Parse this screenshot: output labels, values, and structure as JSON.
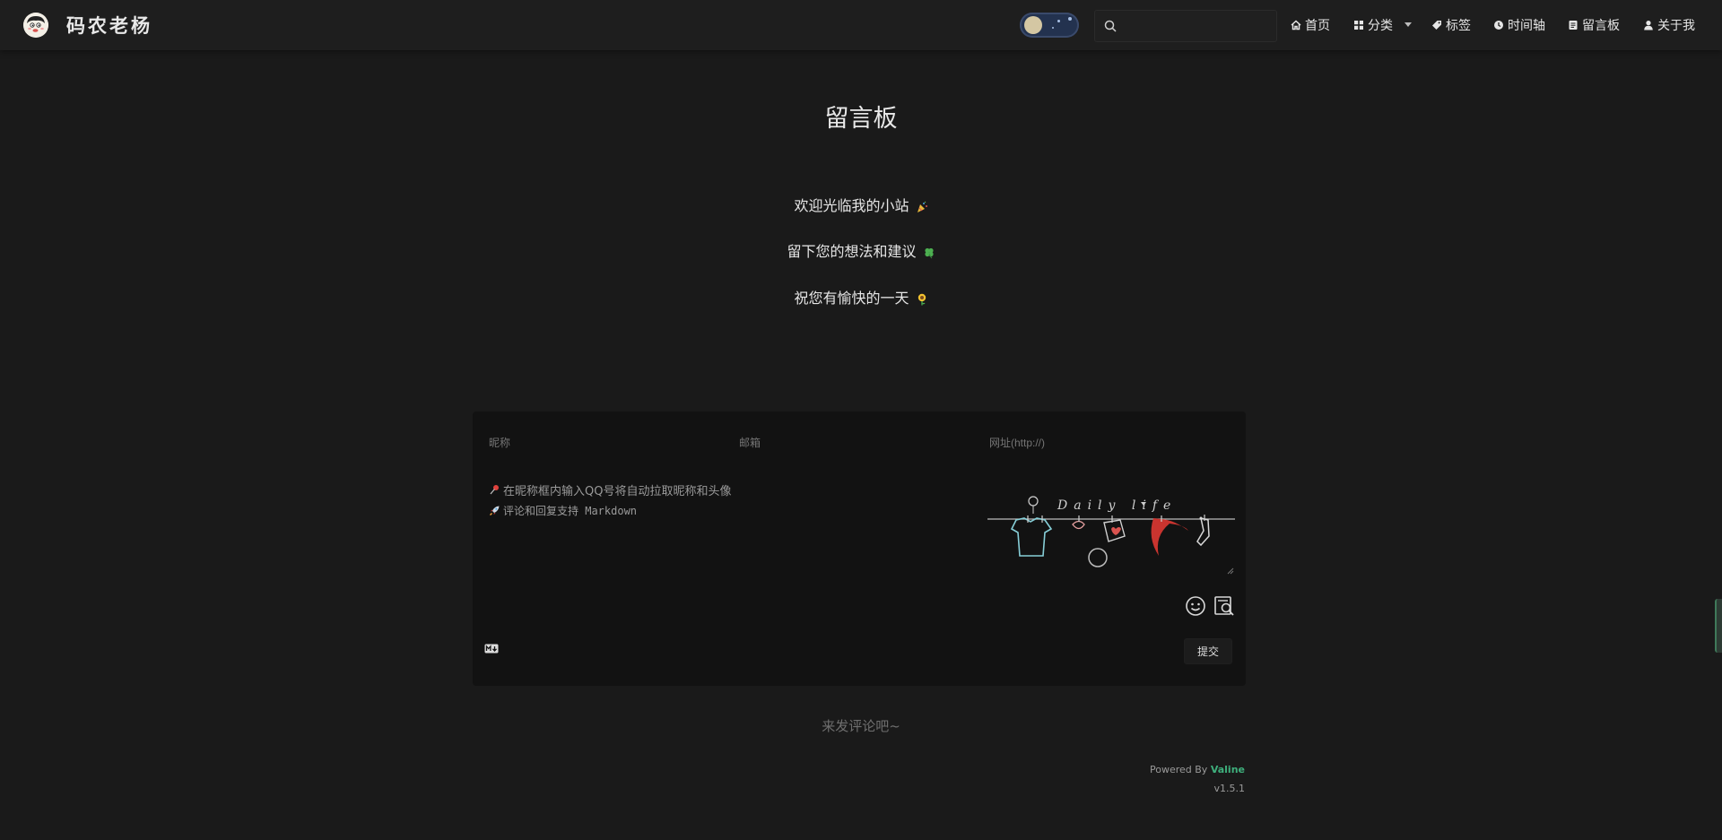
{
  "header": {
    "brand": "码农老杨",
    "search": {
      "placeholder": "",
      "value": ""
    },
    "nav": [
      {
        "label": "首页",
        "icon": "home-icon"
      },
      {
        "label": "分类",
        "icon": "grid-icon",
        "has_dropdown": true
      },
      {
        "label": "标签",
        "icon": "tag-icon"
      },
      {
        "label": "时间轴",
        "icon": "clock-icon"
      },
      {
        "label": "留言板",
        "icon": "board-icon"
      },
      {
        "label": "关于我",
        "icon": "user-icon"
      }
    ]
  },
  "page": {
    "title": "留言板",
    "intro": [
      {
        "text": "欢迎光临我的小站",
        "emoji": "party-popper"
      },
      {
        "text": "留下您的想法和建议",
        "emoji": "four-leaf-clover"
      },
      {
        "text": "祝您有愉快的一天",
        "emoji": "sunflower"
      }
    ]
  },
  "comment_form": {
    "nick_placeholder": "昵称",
    "mail_placeholder": "邮箱",
    "link_placeholder": "网址(http://)",
    "hint_1": "在昵称框内输入QQ号将自动拉取昵称和头像",
    "hint_2": "评论和回复支持 Markdown",
    "drawing_text": "Daily life",
    "submit_label": "提交"
  },
  "comments": {
    "empty_text": "来发评论吧~"
  },
  "footer": {
    "powered_prefix": "Powered By ",
    "powered_name": "Valine",
    "version": "v1.5.1"
  },
  "colors": {
    "background": "#1a1a1a",
    "header": "#1e1e1e",
    "panel": "#121212",
    "accent": "#3eaf7c"
  }
}
